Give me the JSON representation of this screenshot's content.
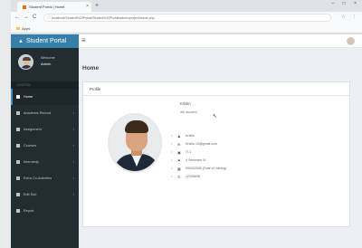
{
  "browser": {
    "tab_title": "Student Portal | Home",
    "tab_close": "×",
    "new_tab": "+",
    "window_controls": "– □ ×",
    "back": "←",
    "forward": "→",
    "reload": "C",
    "address": "localhost/Student%20Portal/Student%20Portal/admin/project/home.php",
    "toolbar_right": "☆ ⋮",
    "bookmark": "Apps"
  },
  "sidebar": {
    "brand": "Student Portal",
    "brand_icon": "graduation-icon",
    "welcome": "Welcome",
    "username": "Admin",
    "nav_header": "GENERAL",
    "items": [
      {
        "label": "Home",
        "active": true,
        "arrow": ""
      },
      {
        "label": "Academic Record",
        "active": false,
        "arrow": "‹"
      },
      {
        "label": "Assignment",
        "active": false,
        "arrow": "‹"
      },
      {
        "label": "Courses",
        "active": false,
        "arrow": "‹"
      },
      {
        "label": "Internship",
        "active": false,
        "arrow": "‹"
      },
      {
        "label": "Extra Co-Activities",
        "active": false,
        "arrow": "‹"
      },
      {
        "label": "Edit Sub",
        "active": false,
        "arrow": "‹"
      },
      {
        "label": "Report",
        "active": false,
        "arrow": ""
      }
    ]
  },
  "topbar": {
    "menu_icon": "≡"
  },
  "main": {
    "page_title": "Home",
    "box_title": "Profile",
    "profile_name": "Kristin",
    "profile_role": "4th student",
    "details": [
      {
        "icon": "user-icon",
        "glyph": "♟",
        "text": "Kristin"
      },
      {
        "icon": "envelope-icon",
        "glyph": "✉",
        "text": "Kristin.19@gmail.com"
      },
      {
        "icon": "id-icon",
        "glyph": "▣",
        "text": "IT-1"
      },
      {
        "icon": "pin-icon",
        "glyph": "⚑",
        "text": "4 Semester III"
      },
      {
        "icon": "calendar-icon",
        "glyph": "▦",
        "text": "09/03/2000 (Date of Joining)"
      },
      {
        "icon": "phone-icon",
        "glyph": "✆",
        "text": "12345698"
      }
    ]
  }
}
